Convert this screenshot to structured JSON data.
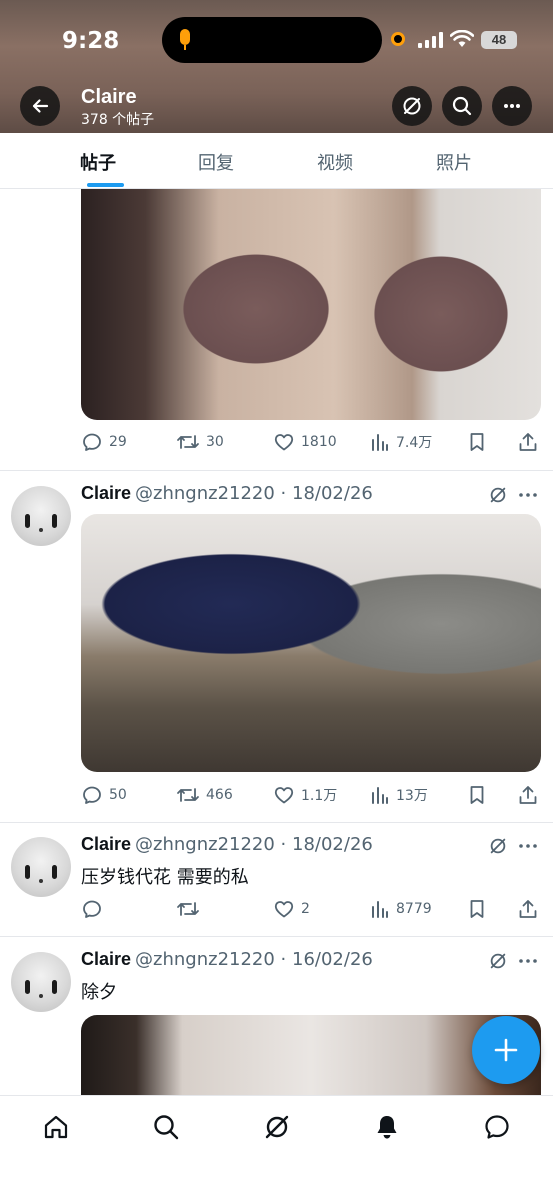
{
  "status_bar": {
    "time": "9:28",
    "battery": "48"
  },
  "header": {
    "name": "Claire",
    "post_count": "378 个帖子"
  },
  "tabs": [
    {
      "label": "帖子",
      "active": true
    },
    {
      "label": "回复",
      "active": false
    },
    {
      "label": "视频",
      "active": false
    },
    {
      "label": "照片",
      "active": false
    }
  ],
  "posts": [
    {
      "stats": {
        "replies": "29",
        "reposts": "30",
        "likes": "1810",
        "views": "7.4万"
      }
    },
    {
      "name": "Claire",
      "meta": "@zhngnz21220 · 18/02/26",
      "text": "",
      "stats": {
        "replies": "50",
        "reposts": "466",
        "likes": "1.1万",
        "views": "13万"
      }
    },
    {
      "name": "Claire",
      "meta": "@zhngnz21220 · 18/02/26",
      "text": "压岁钱代花 需要的私",
      "stats": {
        "replies": "",
        "reposts": "",
        "likes": "2",
        "views": "8779"
      }
    },
    {
      "name": "Claire",
      "meta": "@zhngnz21220 · 16/02/26",
      "text": "除夕"
    }
  ],
  "colors": {
    "accent": "#1d9bf0",
    "secondary_text": "#536471",
    "primary_text": "#0f1419"
  },
  "icons": {
    "header": [
      "back-arrow-icon",
      "grok-icon",
      "search-icon",
      "more-icon"
    ],
    "actions": [
      "reply-icon",
      "repost-icon",
      "like-icon",
      "views-icon",
      "bookmark-icon",
      "share-icon"
    ],
    "nav": [
      "home-icon",
      "search-icon",
      "grok-icon",
      "notifications-icon",
      "messages-icon"
    ],
    "fab": "plus-icon"
  }
}
